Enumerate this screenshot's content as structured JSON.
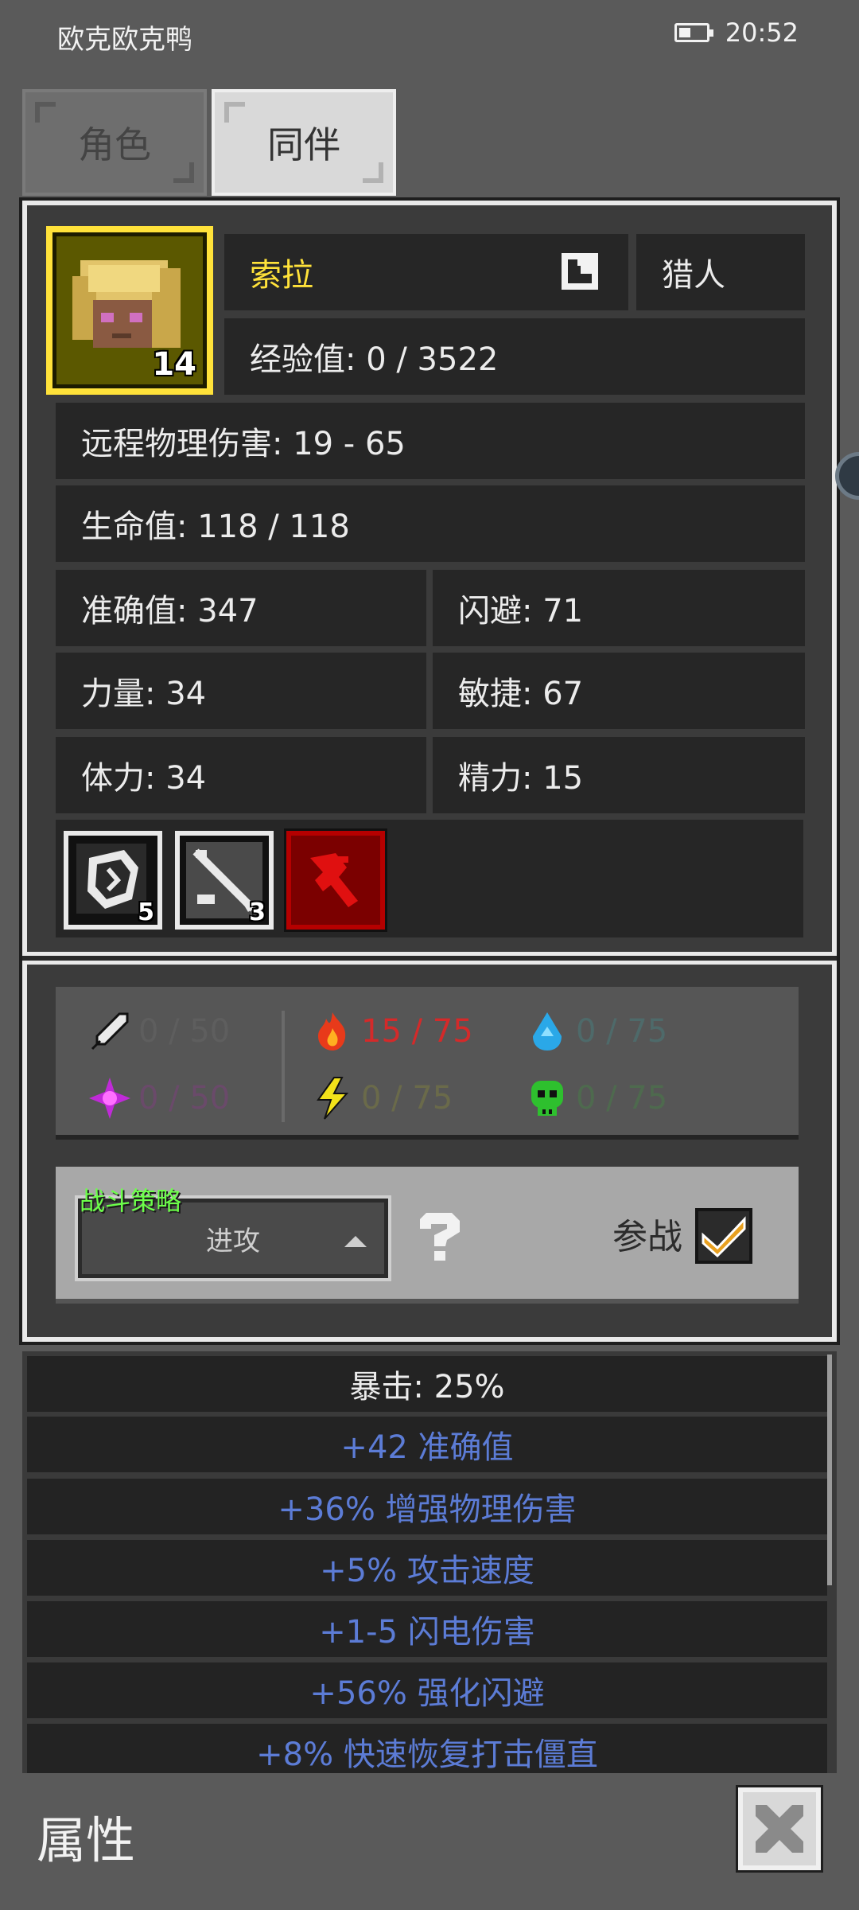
{
  "status_bar": {
    "app_name": "欧克欧克鸭",
    "time": "20:52"
  },
  "tabs": [
    {
      "label": "角色",
      "active": false
    },
    {
      "label": "同伴",
      "active": true
    }
  ],
  "companion": {
    "name": "索拉",
    "class": "猎人",
    "level": "14",
    "exp": "经验值: 0 / 3522",
    "damage": "远程物理伤害: 19 - 65",
    "hp": "生命值: 118 / 118",
    "accuracy": "准确值: 347",
    "dodge": "闪避: 71",
    "strength": "力量: 34",
    "agility": "敏捷: 67",
    "stamina": "体力: 34",
    "energy": "精力: 15"
  },
  "skills": [
    {
      "icon": "shield-skill-icon",
      "count": "5"
    },
    {
      "icon": "arrow-skill-icon",
      "count": "3"
    },
    {
      "icon": "red-beast-skill-icon",
      "count": ""
    }
  ],
  "resistances": {
    "physical": {
      "icon": "physical-resist-icon",
      "value": "0 / 50",
      "color": "#5e5e5e"
    },
    "fire": {
      "icon": "fire-icon",
      "value": "15 / 75",
      "color": "#d42a2a"
    },
    "water": {
      "icon": "water-icon",
      "value": "0 / 75",
      "color": "#4e6a6a"
    },
    "arcane": {
      "icon": "arcane-icon",
      "value": "0 / 50",
      "color": "#6a4a6a"
    },
    "lightning": {
      "icon": "lightning-icon",
      "value": "0 / 75",
      "color": "#6a6a4a"
    },
    "poison": {
      "icon": "poison-skull-icon",
      "value": "0 / 75",
      "color": "#4e6a4e"
    }
  },
  "strategy": {
    "label": "战斗策略",
    "selected": "进攻",
    "join_label": "参战",
    "join_checked": true
  },
  "bonuses": [
    "暴击: 25%",
    "+42 准确值",
    "+36% 增强物理伤害",
    "+5% 攻击速度",
    "+1-5 闪电伤害",
    "+56% 强化闪避",
    "+8% 快速恢复打击僵直"
  ],
  "footer": {
    "title": "属性"
  },
  "colors": {
    "accent_yellow": "#ffe23a",
    "bonus_blue": "#5c7cd6",
    "strategy_green": "#6cff4a"
  }
}
